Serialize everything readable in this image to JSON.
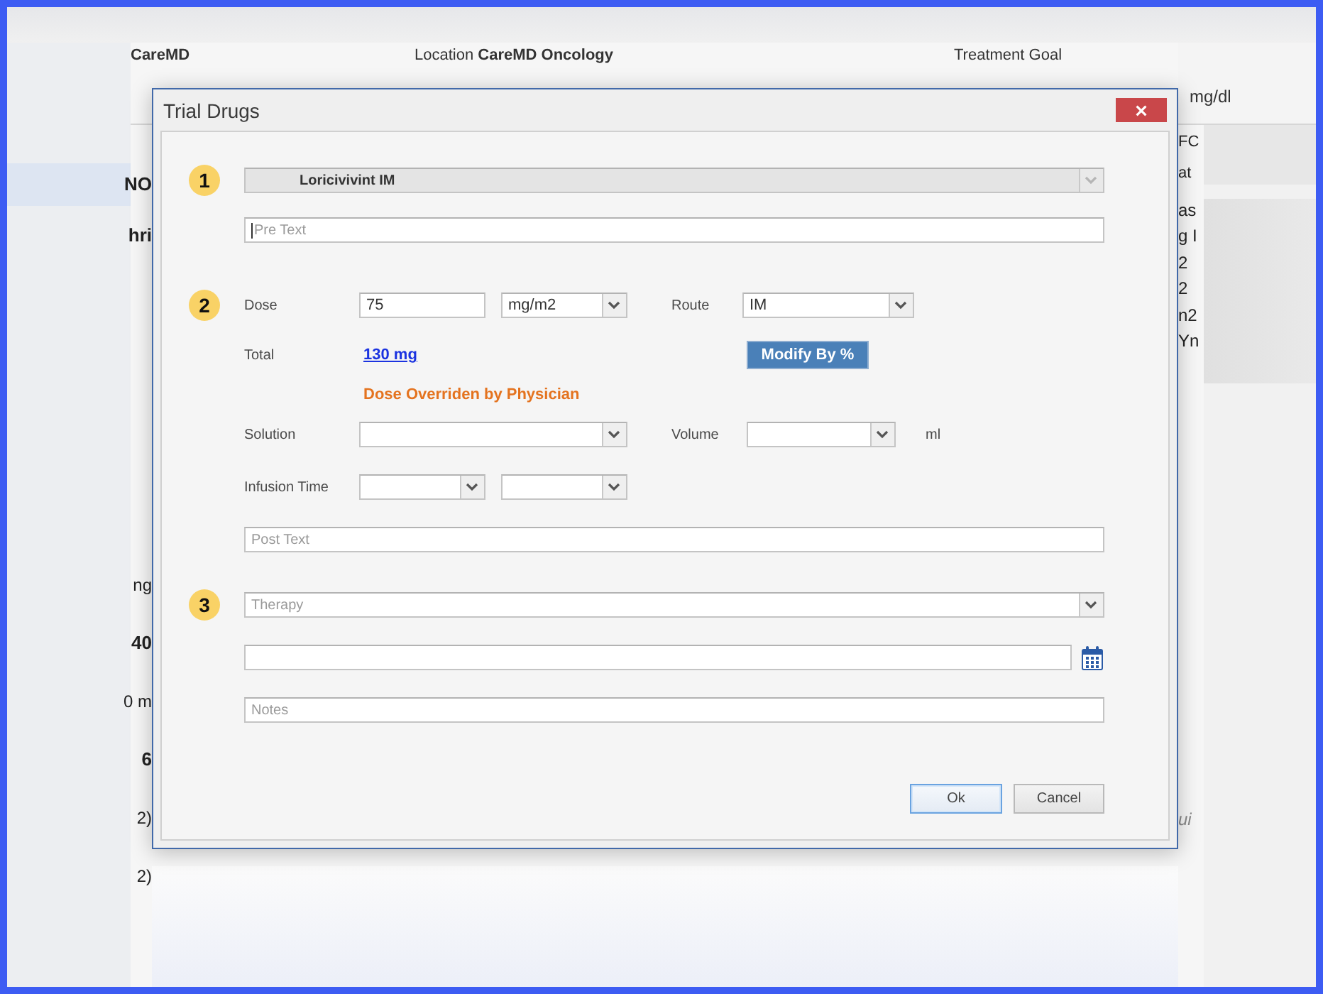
{
  "background": {
    "header": {
      "account": "CareMD",
      "location": "Location **CareMD Oncology**",
      "treatment_goal": "Treatment Goal"
    },
    "unit": "mg/dl",
    "left_fragments_top": [
      {
        "text": "NO",
        "kind": "bold"
      },
      {
        "text": "hri",
        "kind": "bold"
      }
    ],
    "left_fragments_bottom": [
      {
        "text": "ng",
        "kind": "plain"
      },
      {
        "text": "40",
        "kind": "bold"
      },
      {
        "text": "0 m",
        "kind": "plain"
      },
      {
        "text": "6",
        "kind": "bold"
      },
      {
        "text": "2)",
        "kind": "plain"
      },
      {
        "text": "2)",
        "kind": "plain"
      }
    ],
    "right_fragments_top": [
      "FC",
      "at"
    ],
    "right_fragments_middle": [
      "as",
      "g I",
      "2",
      "2",
      "n2",
      "Yn"
    ],
    "right_note": "ui"
  },
  "dialog": {
    "title": "Trial Drugs",
    "step_1": {
      "number": "1",
      "drug": {
        "value": "Loricivivint IM",
        "disabled": true
      },
      "pre_text": {
        "placeholder": "Pre Text",
        "focused": true
      }
    },
    "step_2": {
      "number": "2",
      "dose": {
        "label": "Dose",
        "value": "75",
        "unit": "mg/m2"
      },
      "route": {
        "label": "Route",
        "value": "IM"
      },
      "total": {
        "label": "Total",
        "value": "130 mg"
      },
      "modify_button": "Modify By %",
      "override_note": "Dose Overriden by Physician",
      "solution": {
        "label": "Solution"
      },
      "volume": {
        "label": "Volume",
        "unit": "ml"
      },
      "infusion_time": {
        "label": "Infusion Time"
      },
      "post_text": {
        "placeholder": "Post Text"
      }
    },
    "step_3": {
      "number": "3",
      "therapy": {
        "placeholder": "Therapy"
      },
      "notes": {
        "placeholder": "Notes"
      }
    },
    "buttons": [
      {
        "label": "Ok",
        "focused": true
      },
      {
        "label": "Cancel",
        "focused": false
      }
    ]
  }
}
